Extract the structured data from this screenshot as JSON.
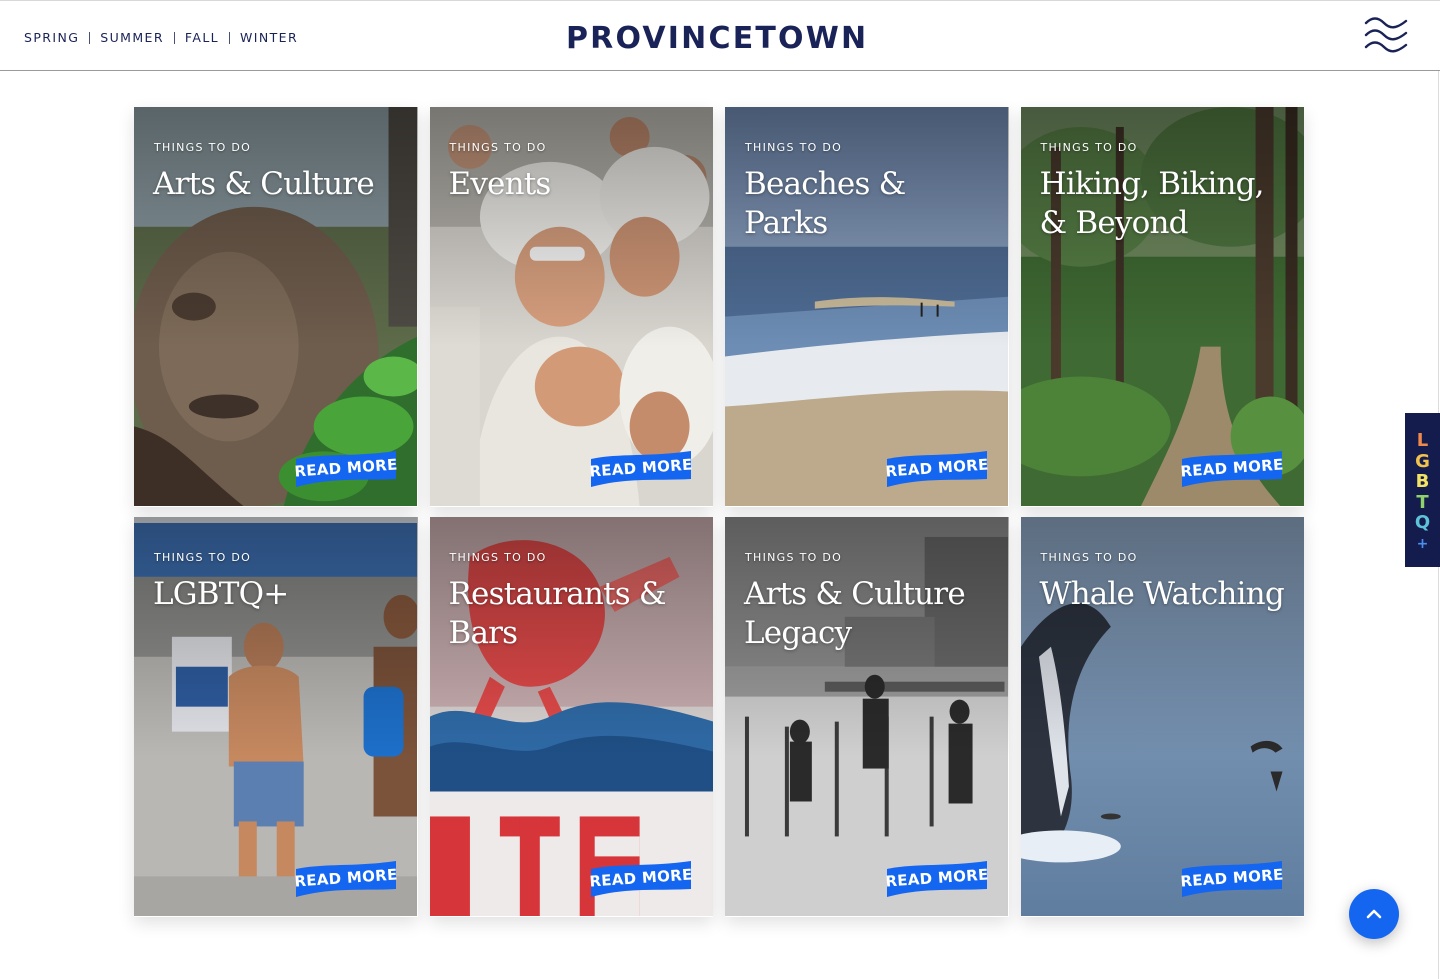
{
  "header": {
    "seasons": [
      "SPRING",
      "SUMMER",
      "FALL",
      "WINTER"
    ],
    "logo": "PROVINCETOWN",
    "menu_icon": "waves-menu-icon"
  },
  "cards": [
    {
      "kicker": "THINGS TO DO",
      "title": "Arts & Culture",
      "cta": "READ MORE"
    },
    {
      "kicker": "THINGS TO DO",
      "title": "Events",
      "cta": "READ MORE"
    },
    {
      "kicker": "THINGS TO DO",
      "title": "Beaches & Parks",
      "cta": "READ MORE"
    },
    {
      "kicker": "THINGS TO DO",
      "title": "Hiking, Biking, & Beyond",
      "cta": "READ MORE"
    },
    {
      "kicker": "THINGS TO DO",
      "title": "LGBTQ+",
      "cta": "READ MORE"
    },
    {
      "kicker": "THINGS TO DO",
      "title": "Restaurants & Bars",
      "cta": "READ MORE"
    },
    {
      "kicker": "THINGS TO DO",
      "title": "Arts & Culture Legacy",
      "cta": "READ MORE"
    },
    {
      "kicker": "THINGS TO DO",
      "title": "Whale Watching",
      "cta": "READ MORE"
    }
  ],
  "side_tab": {
    "letters": [
      "L",
      "G",
      "B",
      "T",
      "Q",
      "+"
    ],
    "colors": [
      "#f08a4b",
      "#f2c14e",
      "#f5e463",
      "#8fd16a",
      "#5ec2d8",
      "#4a8ff0"
    ]
  },
  "colors": {
    "brand_navy": "#1a2357",
    "accent_blue": "#1466f0"
  },
  "back_to_top_icon": "chevron-up-icon"
}
